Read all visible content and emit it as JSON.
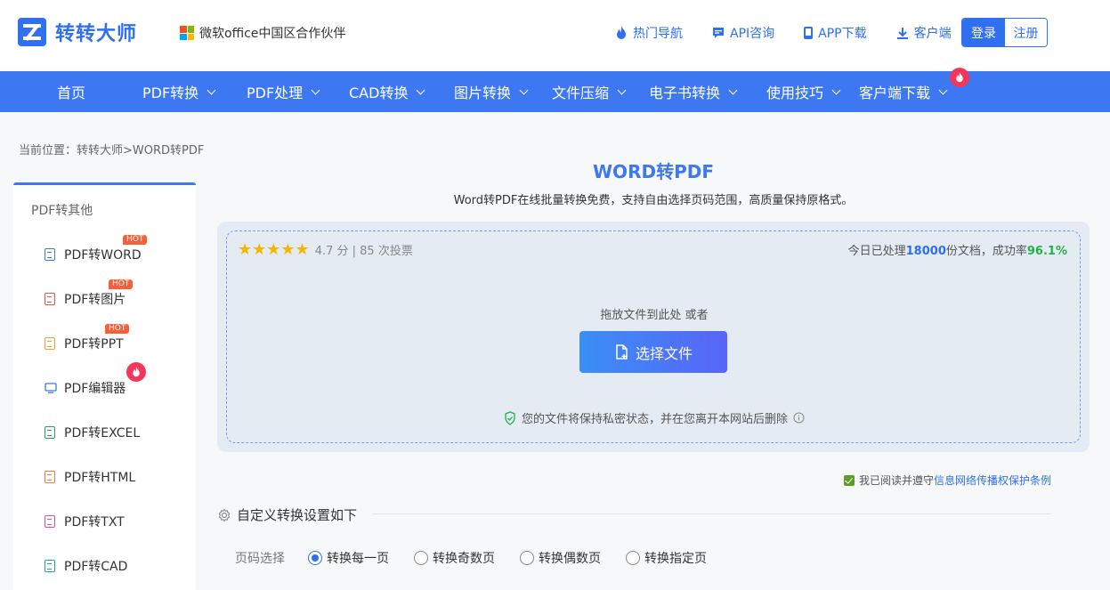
{
  "header": {
    "logo_text": "转转大师",
    "partner_text": "微软office中国区合作伙伴",
    "links": [
      "热门导航",
      "API咨询",
      "APP下载",
      "客户端"
    ],
    "login": "登录",
    "register": "注册"
  },
  "nav": {
    "items": [
      "首页",
      "PDF转换",
      "PDF处理",
      "CAD转换",
      "图片转换",
      "文件压缩",
      "电子书转换",
      "使用技巧",
      "客户端下载"
    ]
  },
  "breadcrumb": "当前位置：转转大师>WORD转PDF",
  "sidebar": {
    "heading": "PDF转其他",
    "items": [
      {
        "label": "PDF转WORD",
        "badge": "HOT",
        "color": "#3d78f2"
      },
      {
        "label": "PDF转图片",
        "badge": "HOT",
        "color": "#e8534a"
      },
      {
        "label": "PDF转PPT",
        "badge": "HOT",
        "color": "#f0a030"
      },
      {
        "label": "PDF编辑器",
        "badge": "",
        "color": "#3d78f2"
      },
      {
        "label": "PDF转EXCEL",
        "badge": "",
        "color": "#22a35a"
      },
      {
        "label": "PDF转HTML",
        "badge": "",
        "color": "#f07a3a"
      },
      {
        "label": "PDF转TXT",
        "badge": "",
        "color": "#e0509a"
      },
      {
        "label": "PDF转CAD",
        "badge": "",
        "color": "#20a89a"
      }
    ]
  },
  "main": {
    "title": "WORD转PDF",
    "description": "Word转PDF在线批量转换免费，支持自由选择页码范围，高质量保持原格式。",
    "rating": {
      "stars": "★★★★★",
      "text": "4.7 分 | 85 次投票",
      "score": 4.7,
      "votes": 85
    },
    "stats": {
      "prefix": "今日已处理",
      "count": "18000",
      "middle": "份文档，成功率",
      "rate": "96.1%"
    },
    "drop_text": "拖放文件到此处 或者",
    "select_button": "选择文件",
    "privacy_text": "您的文件将保持私密状态，并在您离开本网站后删除",
    "agree": {
      "text": "我已阅读并遵守",
      "link": "信息网络传播权保护条例",
      "checked": true
    },
    "settings_title": "自定义转换设置如下",
    "page_select": {
      "label": "页码选择",
      "options": [
        "转换每一页",
        "转换奇数页",
        "转换偶数页",
        "转换指定页"
      ],
      "selected": "转换每一页"
    }
  },
  "colors": {
    "brand": "#2f6ff0",
    "nav_bg": "#3d78f2",
    "hot_badge": "#f5603b",
    "fire_badge": "#f5365c",
    "success": "#22b14c",
    "star": "#f7b500"
  }
}
